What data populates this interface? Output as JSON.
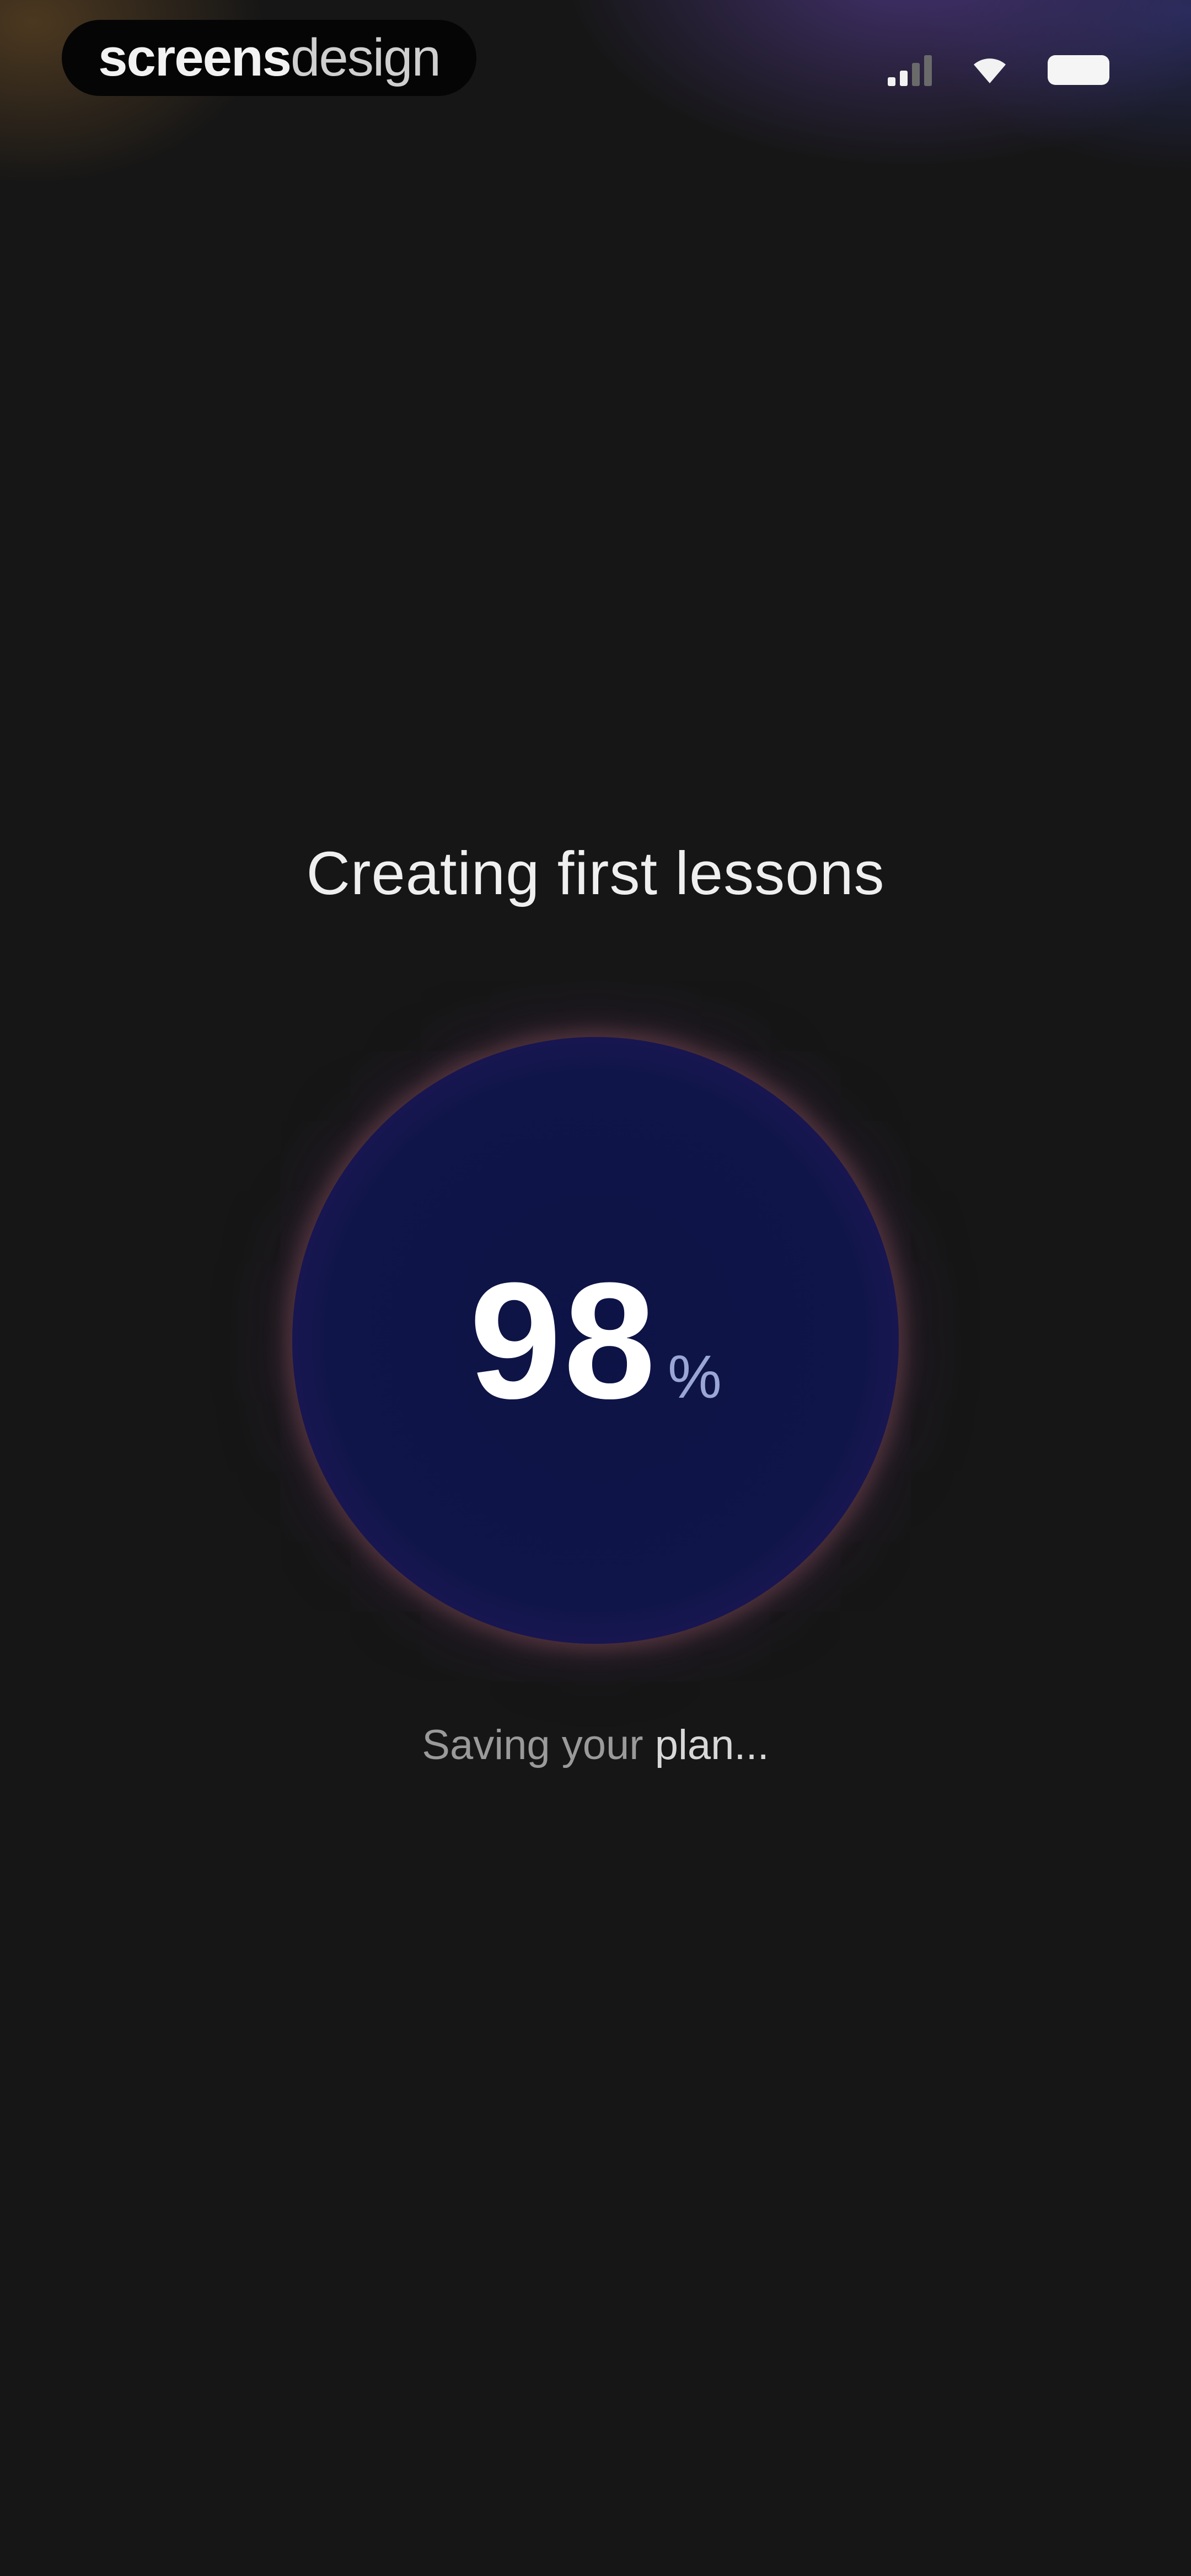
{
  "status_bar": {
    "brand": {
      "strong": "screens",
      "light": "design"
    },
    "signal_icon": "cellular-signal-icon",
    "wifi_icon": "wifi-icon",
    "battery_icon": "battery-icon"
  },
  "main": {
    "title": "Creating first lessons",
    "progress": {
      "value": "98",
      "unit": "%"
    },
    "subtitle": {
      "dim": "Saving your ",
      "bright": "plan..."
    }
  },
  "colors": {
    "background": "#161616",
    "orb_core": "#0f1548",
    "orb_rim": "#e08a55"
  }
}
